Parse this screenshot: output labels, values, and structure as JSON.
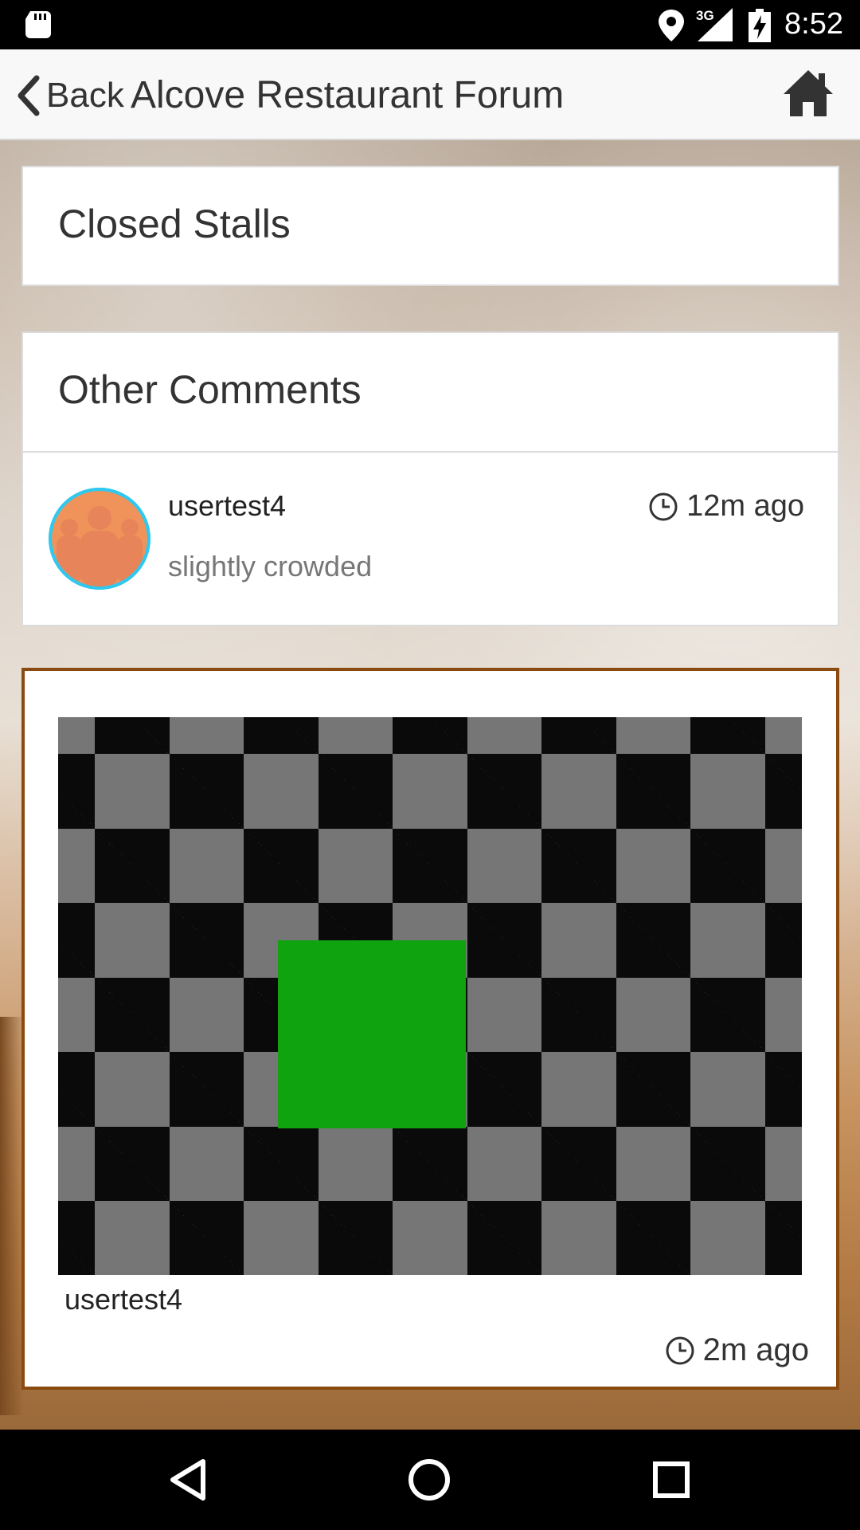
{
  "status_bar": {
    "network": "3G",
    "time": "8:52",
    "icons": [
      "sd-card-icon",
      "location-icon",
      "signal-icon",
      "battery-charging-icon"
    ]
  },
  "app_bar": {
    "back_label": "Back",
    "title": "Alcove Restaurant Forum",
    "icons": [
      "chevron-left-icon",
      "home-icon"
    ]
  },
  "sections": {
    "closed_stalls_title": "Closed Stalls",
    "other_comments_title": "Other Comments"
  },
  "comment": {
    "user": "usertest4",
    "text": "slightly crowded",
    "time": "12m ago",
    "avatar_colors": {
      "ring": "#30c8ee",
      "figure": "#f0935a"
    }
  },
  "photo_post": {
    "user": "usertest4",
    "time": "2m ago",
    "border_color": "#8a4a10",
    "image_colors": {
      "dark": "#0a0a0a",
      "light": "#767676",
      "square": "#10a310"
    }
  },
  "nav_bar": {
    "icons": [
      "back-triangle-icon",
      "home-circle-icon",
      "recents-square-icon"
    ]
  }
}
